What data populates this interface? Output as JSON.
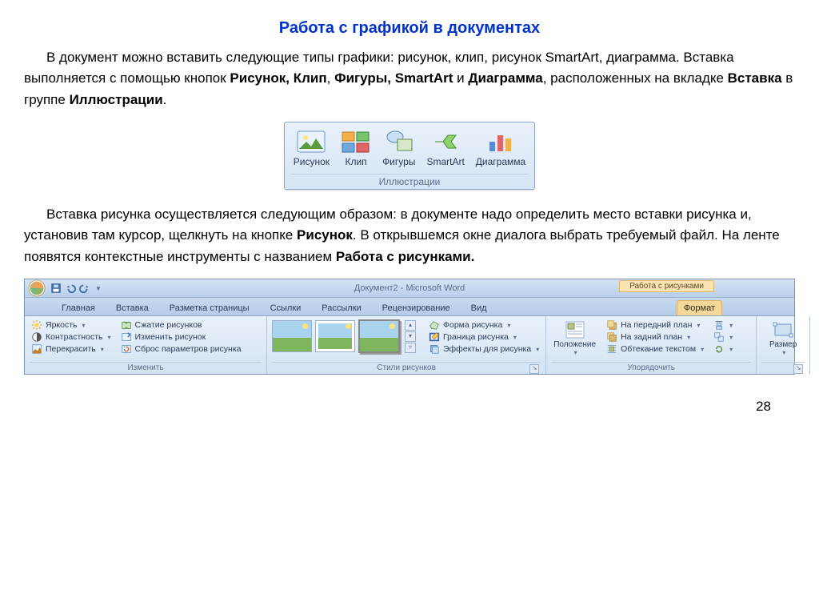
{
  "title": "Работа с графикой в документах",
  "para1_pre": "В документ можно вставить следующие типы графики",
  "para1_post": ": рисунок, клип, рисунок SmartArt, диаграмма. Вставка выполняется с помощью кнопок ",
  "b_picture": "Рисунок, Клип",
  "comma1": ", ",
  "b_shapes": "Фигуры, SmartArt",
  "and": " и ",
  "b_chart": "Диаграмма",
  "para1_tail": ", расположенных на вкладке ",
  "b_insert": "Вставка",
  "in_group": " в группе ",
  "b_illus": "Иллюстрации",
  "dot": ".",
  "illus_group": {
    "caption": "Иллюстрации",
    "items": [
      "Рисунок",
      "Клип",
      "Фигуры",
      "SmartArt",
      "Диаграмма"
    ]
  },
  "para2_a": "Вставка рисунка осуществляется следующим образом: в документе надо определить место вставки рисунка и, установив там курсор, щелкнуть на кнопке ",
  "b_picture2": "Рисунок",
  "para2_b": ". В открывшемся окне диалога выбрать требуемый файл. На ленте появятся контекстные инструменты с названием ",
  "b_picturetools": "Работа с рисунками.",
  "window": {
    "title": "Документ2 - Microsoft Word",
    "context_title": "Работа с рисунками",
    "tabs": [
      "Главная",
      "Вставка",
      "Разметка страницы",
      "Ссылки",
      "Рассылки",
      "Рецензирование",
      "Вид"
    ],
    "active_tab": "Формат",
    "groups": {
      "adjust": {
        "caption": "Изменить",
        "brightness": "Яркость",
        "contrast": "Контрастность",
        "recolor": "Перекрасить",
        "compress": "Сжатие рисунков",
        "change": "Изменить рисунок",
        "reset": "Сброс параметров рисунка"
      },
      "styles": {
        "caption": "Стили рисунков",
        "shape": "Форма рисунка",
        "border": "Граница рисунка",
        "effects": "Эффекты для рисунка"
      },
      "arrange": {
        "caption": "Упорядочить",
        "position": "Положение",
        "front": "На передний план",
        "back": "На задний план",
        "wrap": "Обтекание текстом"
      },
      "size": {
        "caption": "Размер"
      }
    }
  },
  "page_number": "28"
}
